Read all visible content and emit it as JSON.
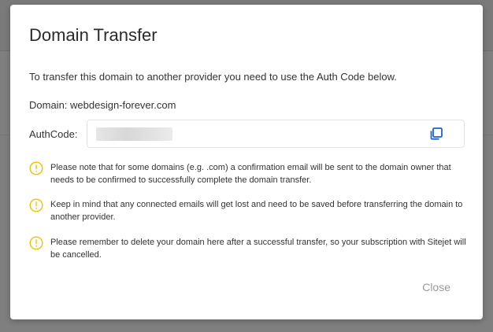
{
  "dialog": {
    "title": "Domain Transfer",
    "intro": "To transfer this domain to another provider you need to use the Auth Code below.",
    "domain_label": "Domain:",
    "domain_value": "webdesign-forever.com",
    "authcode_label": "AuthCode:",
    "authcode_value": "",
    "copy_icon": "copy-icon",
    "notices": [
      {
        "icon": "warning-circle-icon",
        "text": "Please note that for some domains (e.g. .com) a confirmation email will be sent to the domain owner that needs to be confirmed to successfully complete the domain transfer."
      },
      {
        "icon": "warning-circle-icon",
        "text": "Keep in mind that any connected emails will get lost and need to be saved before transferring the domain to another provider."
      },
      {
        "icon": "warning-circle-icon",
        "text": "Please remember to delete your domain here after a successful transfer, so your subscription with Sitejet will be cancelled."
      }
    ],
    "close_label": "Close"
  },
  "colors": {
    "accent": "#1f62c8",
    "warning": "#f2c200",
    "backdrop": "#7f7f7f"
  }
}
